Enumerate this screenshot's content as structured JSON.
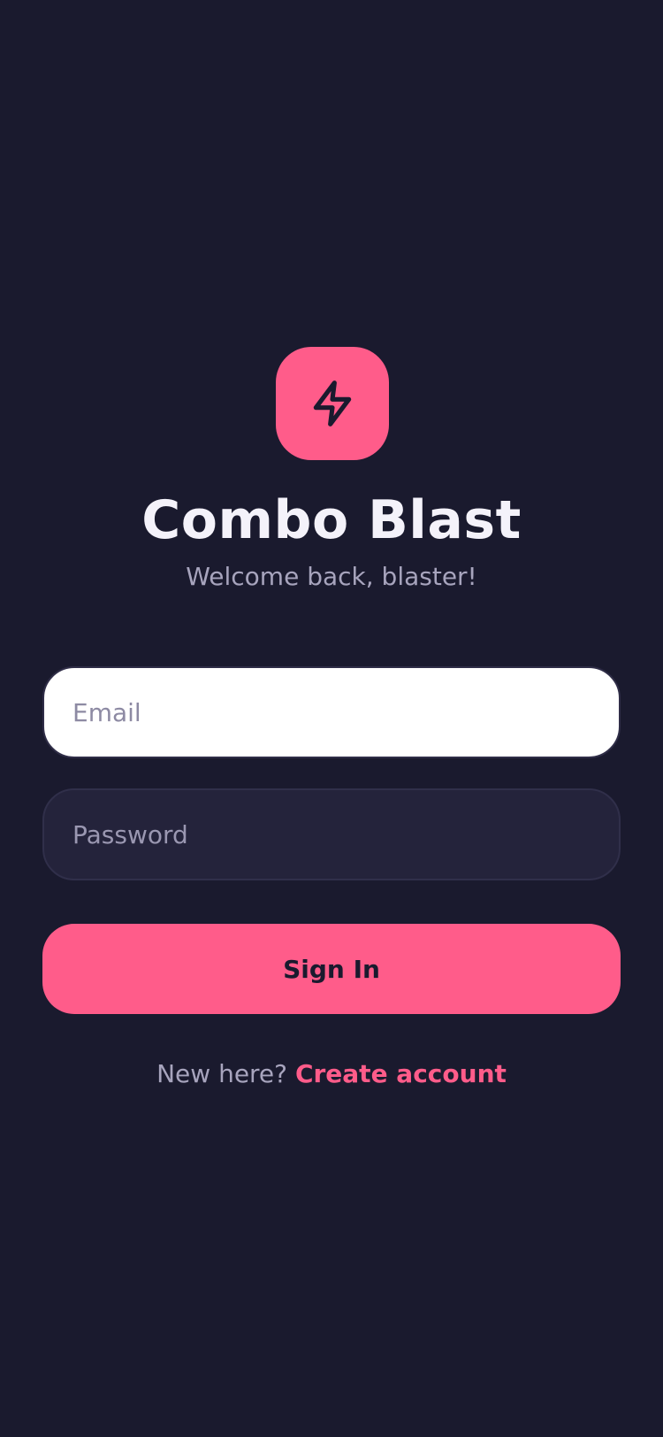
{
  "app": {
    "title": "Combo Blast",
    "subtitle": "Welcome back, blaster!",
    "logo_icon": "lightning-bolt-icon"
  },
  "form": {
    "email": {
      "value": "",
      "placeholder": "Email"
    },
    "password": {
      "value": "",
      "placeholder": "Password"
    },
    "submit_label": "Sign In"
  },
  "footer": {
    "prompt": "New here?",
    "link_label": "Create account"
  },
  "colors": {
    "background": "#1a1a2e",
    "accent": "#ff5c8a",
    "title_text": "#f4f2fa",
    "muted_text": "#a7a4bd",
    "input_light": "#ffffff",
    "input_dark": "#24233b"
  }
}
